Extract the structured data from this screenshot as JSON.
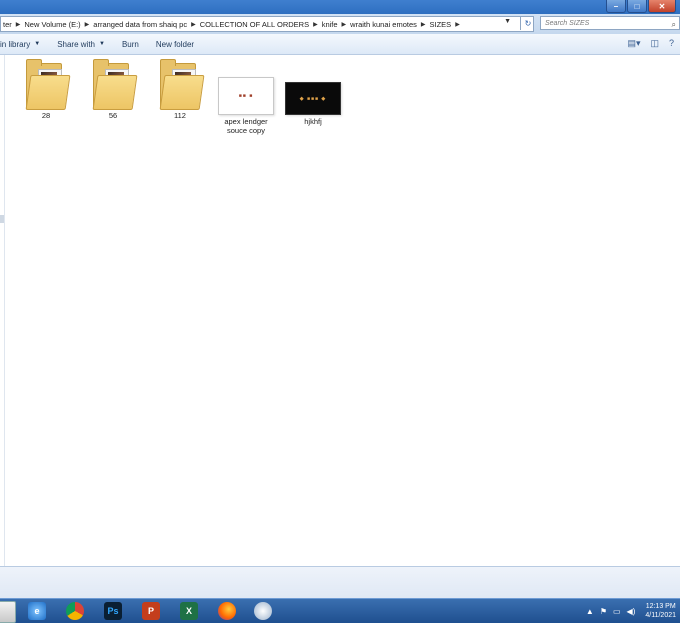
{
  "window": {
    "controls": [
      "–",
      "□",
      "✕"
    ]
  },
  "address": {
    "crumbs": [
      "ter",
      "New Volume (E:)",
      "arranged data from shaiq pc",
      "COLLECTION OF ALL ORDERS",
      "knife",
      "wraith kunai emotes",
      "SIZES"
    ],
    "search_placeholder": "Search SIZES"
  },
  "toolbar": {
    "include_library": "in library",
    "share_with": "Share with",
    "burn": "Burn",
    "new_folder": "New folder"
  },
  "items": [
    {
      "type": "folder",
      "name": "28"
    },
    {
      "type": "folder",
      "name": "56"
    },
    {
      "type": "folder",
      "name": "112"
    },
    {
      "type": "image",
      "name": "apex lendger souce copy"
    },
    {
      "type": "image",
      "name": "hjkhfj"
    }
  ],
  "taskbar": {
    "apps": [
      "internet-explorer",
      "chrome",
      "photoshop",
      "powerpoint",
      "excel",
      "firefox",
      "app"
    ],
    "ps_label": "Ps",
    "ppt_label": "P",
    "xl_label": "X",
    "clock_time": "12:13 PM",
    "clock_date": "4/11/2021"
  }
}
